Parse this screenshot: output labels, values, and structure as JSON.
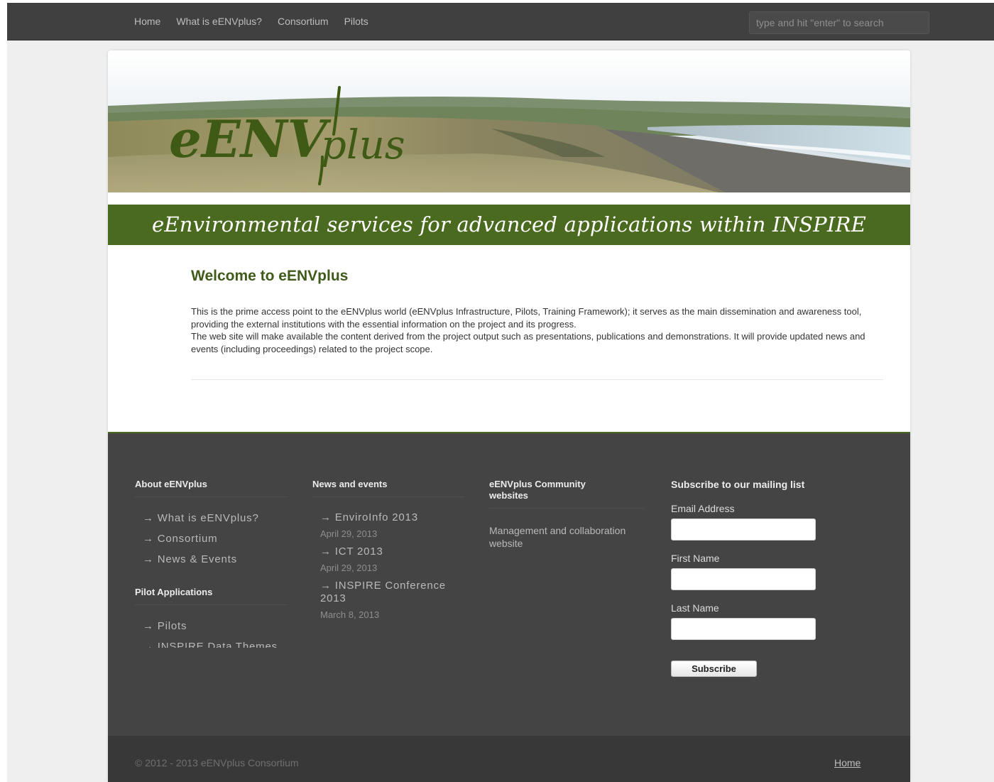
{
  "nav": {
    "links": [
      "Home",
      "What is eENVplus?",
      "Consortium",
      "Pilots"
    ],
    "search_placeholder": "type and hit \"enter\" to search"
  },
  "banner": {
    "logo_text": "eENVplus",
    "tagline": "eEnvironmental services for advanced applications within INSPIRE"
  },
  "main": {
    "title": "Welcome to eENVplus",
    "paragraph1": "This is the prime access point to the eENVplus world (eENVplus Infrastructure, Pilots, Training Framework); it serves as the main dissemination and awareness tool, providing the external institutions with the essential information on the project and its progress.",
    "paragraph2": "The web site will make available the content derived from the project output such as presentations, publications and demonstrations. It will provide updated news and events (including proceedings) related to the project scope."
  },
  "footer": {
    "about": {
      "title": "About eENVplus",
      "items": [
        "→ What is eENVplus?",
        "→ Consortium",
        "→ News & Events"
      ]
    },
    "pilot": {
      "title": "Pilot Applications",
      "items": [
        "→ Pilots",
        "→ INSPIRE Data Themes"
      ]
    },
    "news": {
      "title": "News and events",
      "items": [
        {
          "title": "→ EnviroInfo 2013",
          "date": "April 29, 2013"
        },
        {
          "title": "→ ICT 2013",
          "date": "April 29, 2013"
        },
        {
          "title": "→ INSPIRE Conference 2013",
          "date": "March 8, 2013"
        }
      ]
    },
    "community": {
      "title": "eENVplus Community websites",
      "link": "Management and collaboration website"
    },
    "subscribe": {
      "title": "Subscribe to our mailing list",
      "email_label": "Email Address",
      "first_label": "First Name",
      "last_label": "Last Name",
      "button": "Subscribe"
    },
    "copyright": "© 2012 - 2013 eENVplus Consortium",
    "home_link": "Home"
  },
  "colors": {
    "navbar": "#404040",
    "brand_green": "#4a6a1f",
    "footer": "#444444",
    "bottom_bar": "#383838"
  }
}
